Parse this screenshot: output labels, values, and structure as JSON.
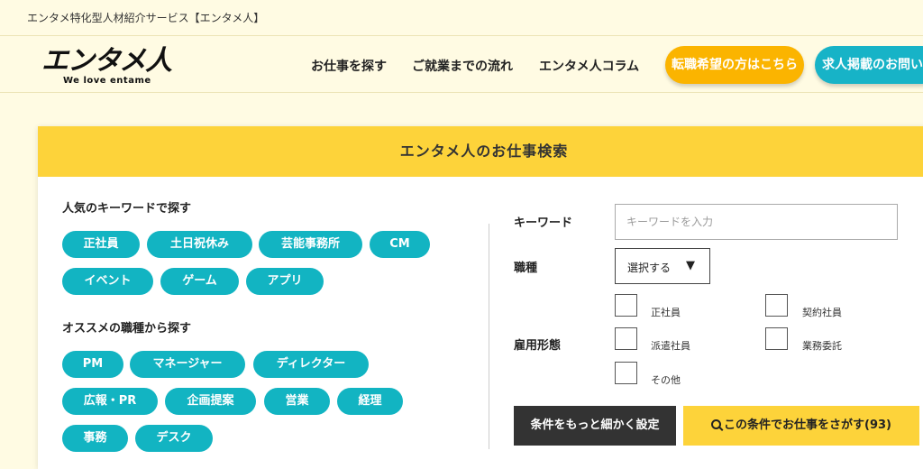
{
  "topbar": {
    "tagline": "エンタメ特化型人材紹介サービス【エンタメ人】"
  },
  "header": {
    "logo_main": "エンタメ人",
    "logo_sub": "We love entame",
    "nav": [
      "お仕事を探す",
      "ご就業までの流れ",
      "エンタメ人コラム"
    ],
    "cta_career": "転職希望の方はこちら",
    "cta_employer": "求人掲載のお問い合"
  },
  "search": {
    "title": "エンタメ人のお仕事検索",
    "popular_title": "人気のキーワードで探す",
    "popular_tags": [
      "正社員",
      "土日祝休み",
      "芸能事務所",
      "CM",
      "イベント",
      "ゲーム",
      "アプリ"
    ],
    "jobtype_title": "オススメの職種から探す",
    "jobtype_tags": [
      "PM",
      "マネージャー",
      "ディレクター",
      "広報・PR",
      "企画提案",
      "営業",
      "経理",
      "事務",
      "デスク"
    ],
    "keyword_label": "キーワード",
    "keyword_placeholder": "キーワードを入力",
    "keyword_value": "",
    "jobtype_label": "職種",
    "jobtype_select": "選択する",
    "employment_label": "雇用形態",
    "employment_options": [
      "正社員",
      "契約社員",
      "派遣社員",
      "業務委託",
      "その他"
    ],
    "detail_button": "条件をもっと細かく設定",
    "search_button": "この条件でお仕事をさがす(93)"
  },
  "colors": {
    "accent_yellow": "#fdd33a",
    "accent_teal": "#12b4c2",
    "orange": "#fbb400",
    "background": "#fffbe3"
  }
}
